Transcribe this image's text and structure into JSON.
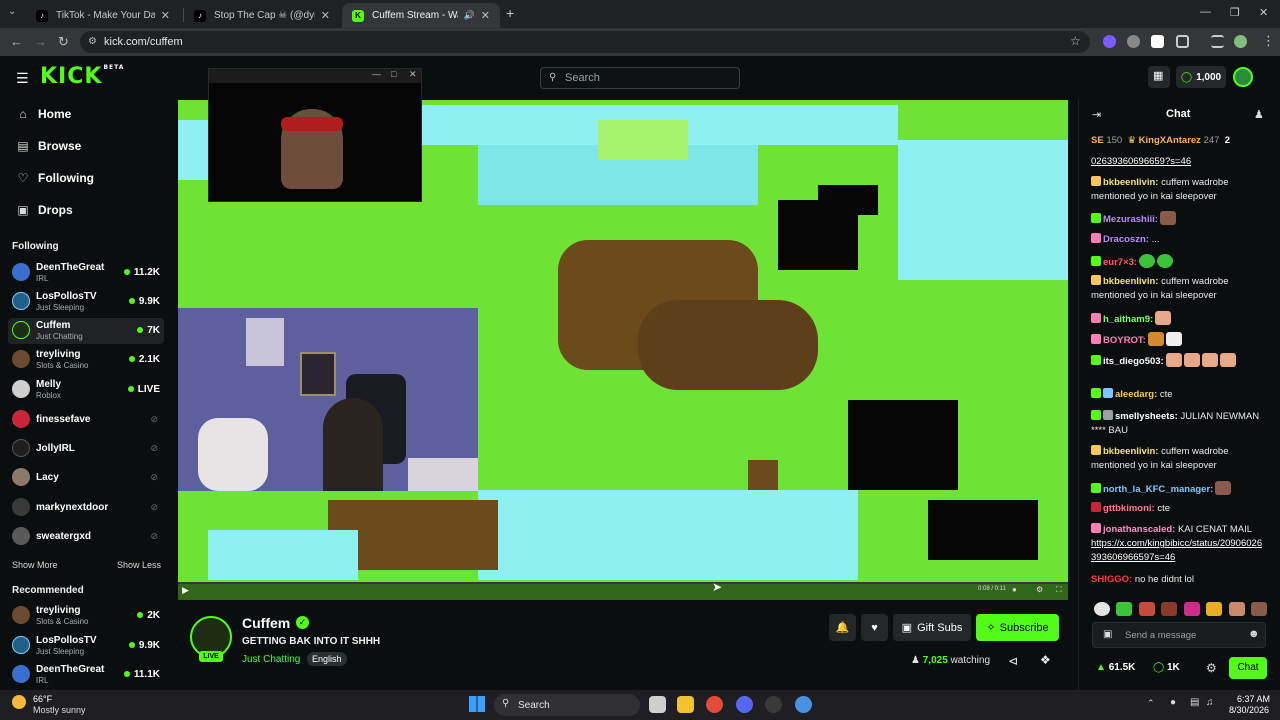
{
  "browser": {
    "tabs": [
      {
        "title": "TikTok - Make Your Day"
      },
      {
        "title": "Stop The Cap ☠ (@dymestayp"
      },
      {
        "title": "Cuffem Stream - Watch Live"
      }
    ],
    "url": "kick.com/cuffem"
  },
  "header": {
    "logo": "KICK",
    "logo_tag": "BETA",
    "search_placeholder": "Search",
    "points": "1,000"
  },
  "sidebar": {
    "nav": [
      {
        "label": "Home",
        "icon": "home-icon"
      },
      {
        "label": "Browse",
        "icon": "browse-icon"
      },
      {
        "label": "Following",
        "icon": "heart-icon"
      },
      {
        "label": "Drops",
        "icon": "gift-icon"
      }
    ],
    "following_title": "Following",
    "following": [
      {
        "name": "DeenTheGreat",
        "sub": "IRL",
        "viewers": "11.2K",
        "status": "live"
      },
      {
        "name": "LosPollosTV",
        "sub": "Just Sleeping",
        "viewers": "9.9K",
        "status": "live"
      },
      {
        "name": "Cuffem",
        "sub": "Just Chatting",
        "viewers": "7K",
        "status": "live"
      },
      {
        "name": "treyliving",
        "sub": "Slots & Casino",
        "viewers": "2.1K",
        "status": "live"
      },
      {
        "name": "Melly",
        "sub": "Roblox",
        "viewers": "LIVE",
        "status": "live"
      },
      {
        "name": "finessefave",
        "sub": "",
        "viewers": "",
        "status": "offline"
      },
      {
        "name": "JollyIRL",
        "sub": "",
        "viewers": "",
        "status": "offline"
      },
      {
        "name": "Lacy",
        "sub": "",
        "viewers": "",
        "status": "offline"
      },
      {
        "name": "markynextdoor",
        "sub": "",
        "viewers": "",
        "status": "offline"
      },
      {
        "name": "sweatergxd",
        "sub": "",
        "viewers": "",
        "status": "offline"
      }
    ],
    "show_more": "Show More",
    "show_less": "Show Less",
    "recommended_title": "Recommended",
    "recommended": [
      {
        "name": "treyliving",
        "sub": "Slots & Casino",
        "viewers": "2K"
      },
      {
        "name": "LosPollosTV",
        "sub": "Just Sleeping",
        "viewers": "9.9K"
      },
      {
        "name": "DeenTheGreat",
        "sub": "IRL",
        "viewers": "11.1K"
      }
    ]
  },
  "player": {
    "time": "0:08 / 0:11"
  },
  "stream": {
    "channel": "Cuffem",
    "live_badge": "LIVE",
    "title": "GETTING BAK INTO IT SHHH",
    "category": "Just Chatting",
    "language": "English",
    "gift_subs": "Gift Subs",
    "subscribe": "Subscribe",
    "watching_count": "7,025",
    "watching_label": "watching"
  },
  "chat": {
    "title": "Chat",
    "top_bar": [
      {
        "name": "SE",
        "value": "150"
      },
      {
        "name": "KingXAntarez",
        "value": "247"
      },
      {
        "name": "",
        "value": "2"
      }
    ],
    "messages": [
      {
        "user": "",
        "text": "02639360696659?s=46",
        "color": "#ffffff"
      },
      {
        "user": "bkbeenlivin:",
        "text": "cuffem wadrobe mentioned yo in kai sleepover",
        "color": "#f6e27a"
      },
      {
        "user": "Mezurashiii:",
        "text": "",
        "color": "#b78bff"
      },
      {
        "user": "Dracoszn:",
        "text": "...",
        "color": "#b78bff"
      },
      {
        "user": "eur7×3:",
        "text": "",
        "color": "#ff5a6a"
      },
      {
        "user": "bkbeenlivin:",
        "text": "cuffem wadrobe mentioned yo in kai sleepover",
        "color": "#f6e27a"
      },
      {
        "user": "h_aitham9:",
        "text": "",
        "color": "#7dfc6a"
      },
      {
        "user": "BOYROT:",
        "text": "",
        "color": "#ff7eb3"
      },
      {
        "user": "its_diego503:",
        "text": "",
        "color": "#ffffff"
      },
      {
        "user": "aleedarg:",
        "text": "cte",
        "color": "#f6c85a"
      },
      {
        "user": "smellysheets:",
        "text": "JULIAN NEWMAN **** BAU",
        "color": "#ffffff"
      },
      {
        "user": "bkbeenlivin:",
        "text": "cuffem wadrobe mentioned yo in kai sleepover",
        "color": "#f6e27a"
      },
      {
        "user": "north_la_KFC_manager:",
        "text": "",
        "color": "#7ec8ff"
      },
      {
        "user": "gttbkimoni:",
        "text": "cte",
        "color": "#ff7b8b"
      },
      {
        "user": "jonathanscaled:",
        "text": "KAI CENAT MAIL",
        "color": "#ff8fd0"
      },
      {
        "user": "",
        "text": "https://x.com/kingbibicc/status/20906026393606966597s=46",
        "color": "#ffffff"
      },
      {
        "user": "SHIGGO:",
        "text": "no he didnt lol",
        "color": "#ff3a3a"
      }
    ],
    "input_placeholder": "Send a message",
    "stat_points": "61.5K",
    "stat_coins": "1K",
    "chat_button": "Chat"
  },
  "taskbar": {
    "weather_temp": "66°F",
    "weather_desc": "Mostly sunny",
    "search": "Search",
    "time": "6:37 AM",
    "date": "8/30/2026"
  }
}
